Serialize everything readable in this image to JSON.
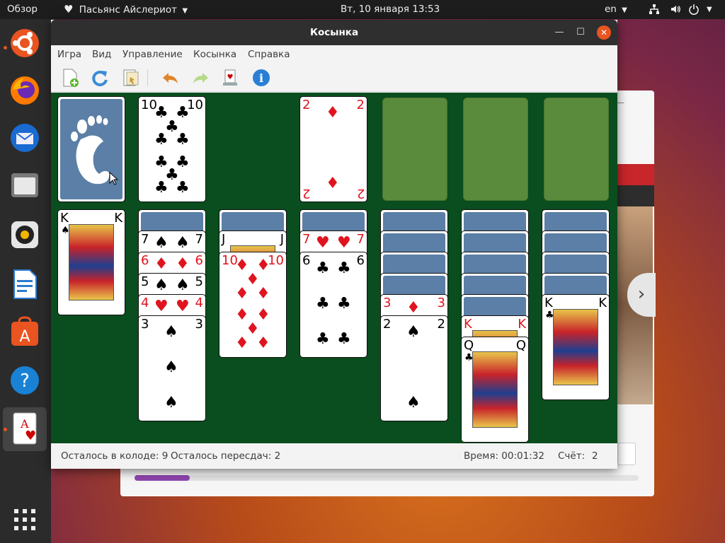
{
  "topbar": {
    "activities": "Обзор",
    "app_menu": "Пасьянс Айслериот",
    "clock": "Вт, 10 января  13:53",
    "lang": "en"
  },
  "window": {
    "title": "Косынка"
  },
  "menu": [
    "Игра",
    "Вид",
    "Управление",
    "Косынка",
    "Справка"
  ],
  "status": {
    "deck": "Осталось в колоде: 9",
    "redeals": "Осталось пересдач: 2",
    "time": "Время: 00:01:32",
    "score_label": "Счёт:",
    "score": "2"
  },
  "background_window": {
    "nav_arrow": "›"
  },
  "cards": {
    "waste": {
      "rank": "10",
      "suit": "♣"
    },
    "foundation_1": {
      "rank": "2",
      "suit": "♦"
    },
    "t1": {
      "rank": "K",
      "suit": "♠"
    },
    "t2_7": {
      "rank": "7",
      "suit": "♠"
    },
    "t2_6": {
      "rank": "6",
      "suit": "♦"
    },
    "t2_5": {
      "rank": "5",
      "suit": "♠"
    },
    "t2_4": {
      "rank": "4",
      "suit": "♥"
    },
    "t2_3": {
      "rank": "3",
      "suit": "♠"
    },
    "t3_j": {
      "rank": "J",
      "suit": ""
    },
    "t3_10": {
      "rank": "10",
      "suit": "♦"
    },
    "t4_7": {
      "rank": "7",
      "suit": "♥"
    },
    "t4_6": {
      "rank": "6",
      "suit": "♣"
    },
    "t5_3": {
      "rank": "3",
      "suit": "♦"
    },
    "t5_2": {
      "rank": "2",
      "suit": "♠"
    },
    "t6_k": {
      "rank": "K",
      "suit": "♦"
    },
    "t6_q": {
      "rank": "Q",
      "suit": "♣"
    },
    "t7_k": {
      "rank": "K",
      "suit": "♣"
    }
  }
}
